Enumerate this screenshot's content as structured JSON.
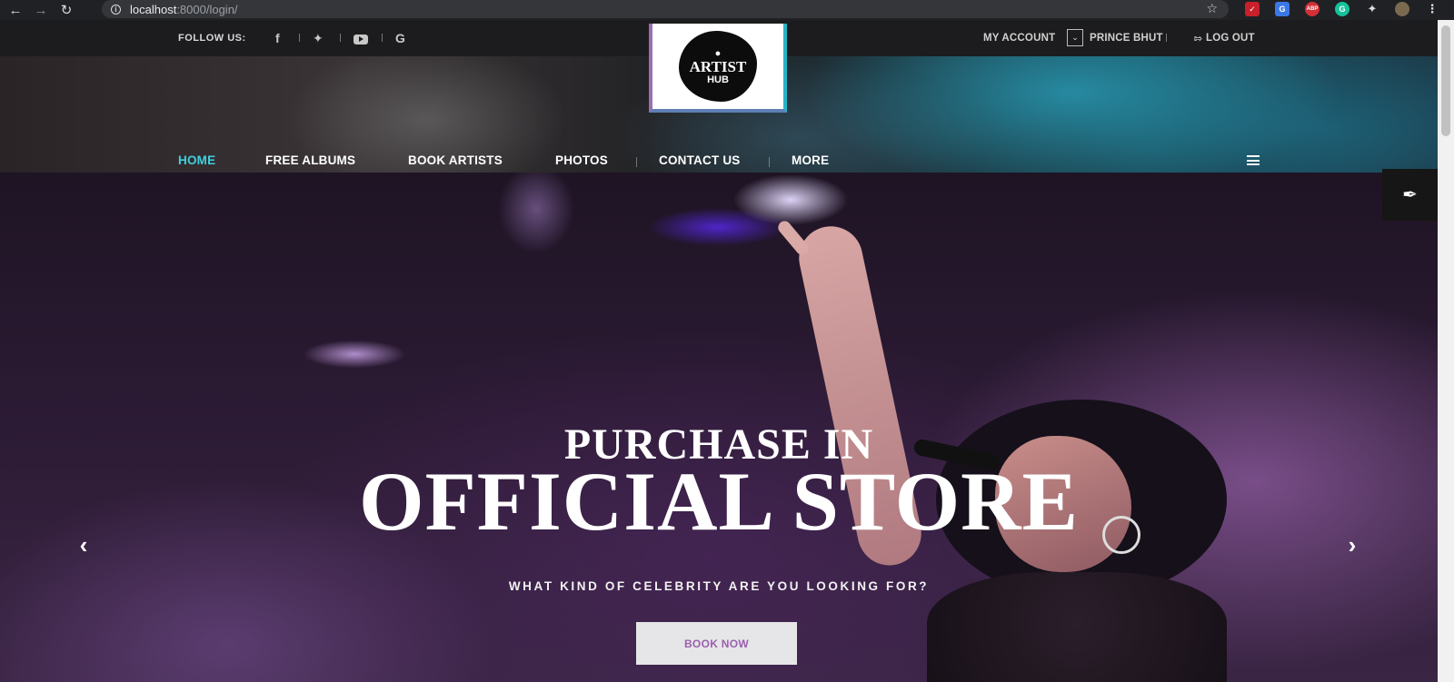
{
  "browser": {
    "url_host": "localhost",
    "url_rest": ":8000/login/",
    "icons": [
      "back-arrow-icon",
      "forward-arrow-icon",
      "reload-icon",
      "info-icon",
      "star-icon",
      "puzzle-icon",
      "more-vert-icon"
    ]
  },
  "topbar": {
    "follow_label": "FOLLOW US:",
    "social_icons": [
      "facebook-icon",
      "twitter-icon",
      "youtube-icon",
      "google-icon"
    ],
    "my_account": "MY ACCOUNT",
    "user_name": "PRINCE BHUT",
    "logout": "LOG OUT"
  },
  "logo": {
    "line1": "ARTIST",
    "line2": "HUB"
  },
  "nav": {
    "items": [
      {
        "label": "HOME"
      },
      {
        "label": "FREE ALBUMS"
      },
      {
        "label": "BOOK ARTISTS"
      },
      {
        "label": "PHOTOS"
      },
      {
        "label": "CONTACT US"
      },
      {
        "label": "MORE"
      }
    ],
    "active": "HOME",
    "active_color": "#3fd0e0"
  },
  "hero": {
    "line1": "PURCHASE IN",
    "line2": "OFFICIAL STORE",
    "subtitle": "WHAT KIND OF CELEBRITY ARE YOU LOOKING FOR?",
    "button": "BOOK NOW",
    "button_text_color": "#9a5fae"
  },
  "colors": {
    "accent": "#3fd0e0",
    "topbar_bg": "#1c1c1e"
  }
}
